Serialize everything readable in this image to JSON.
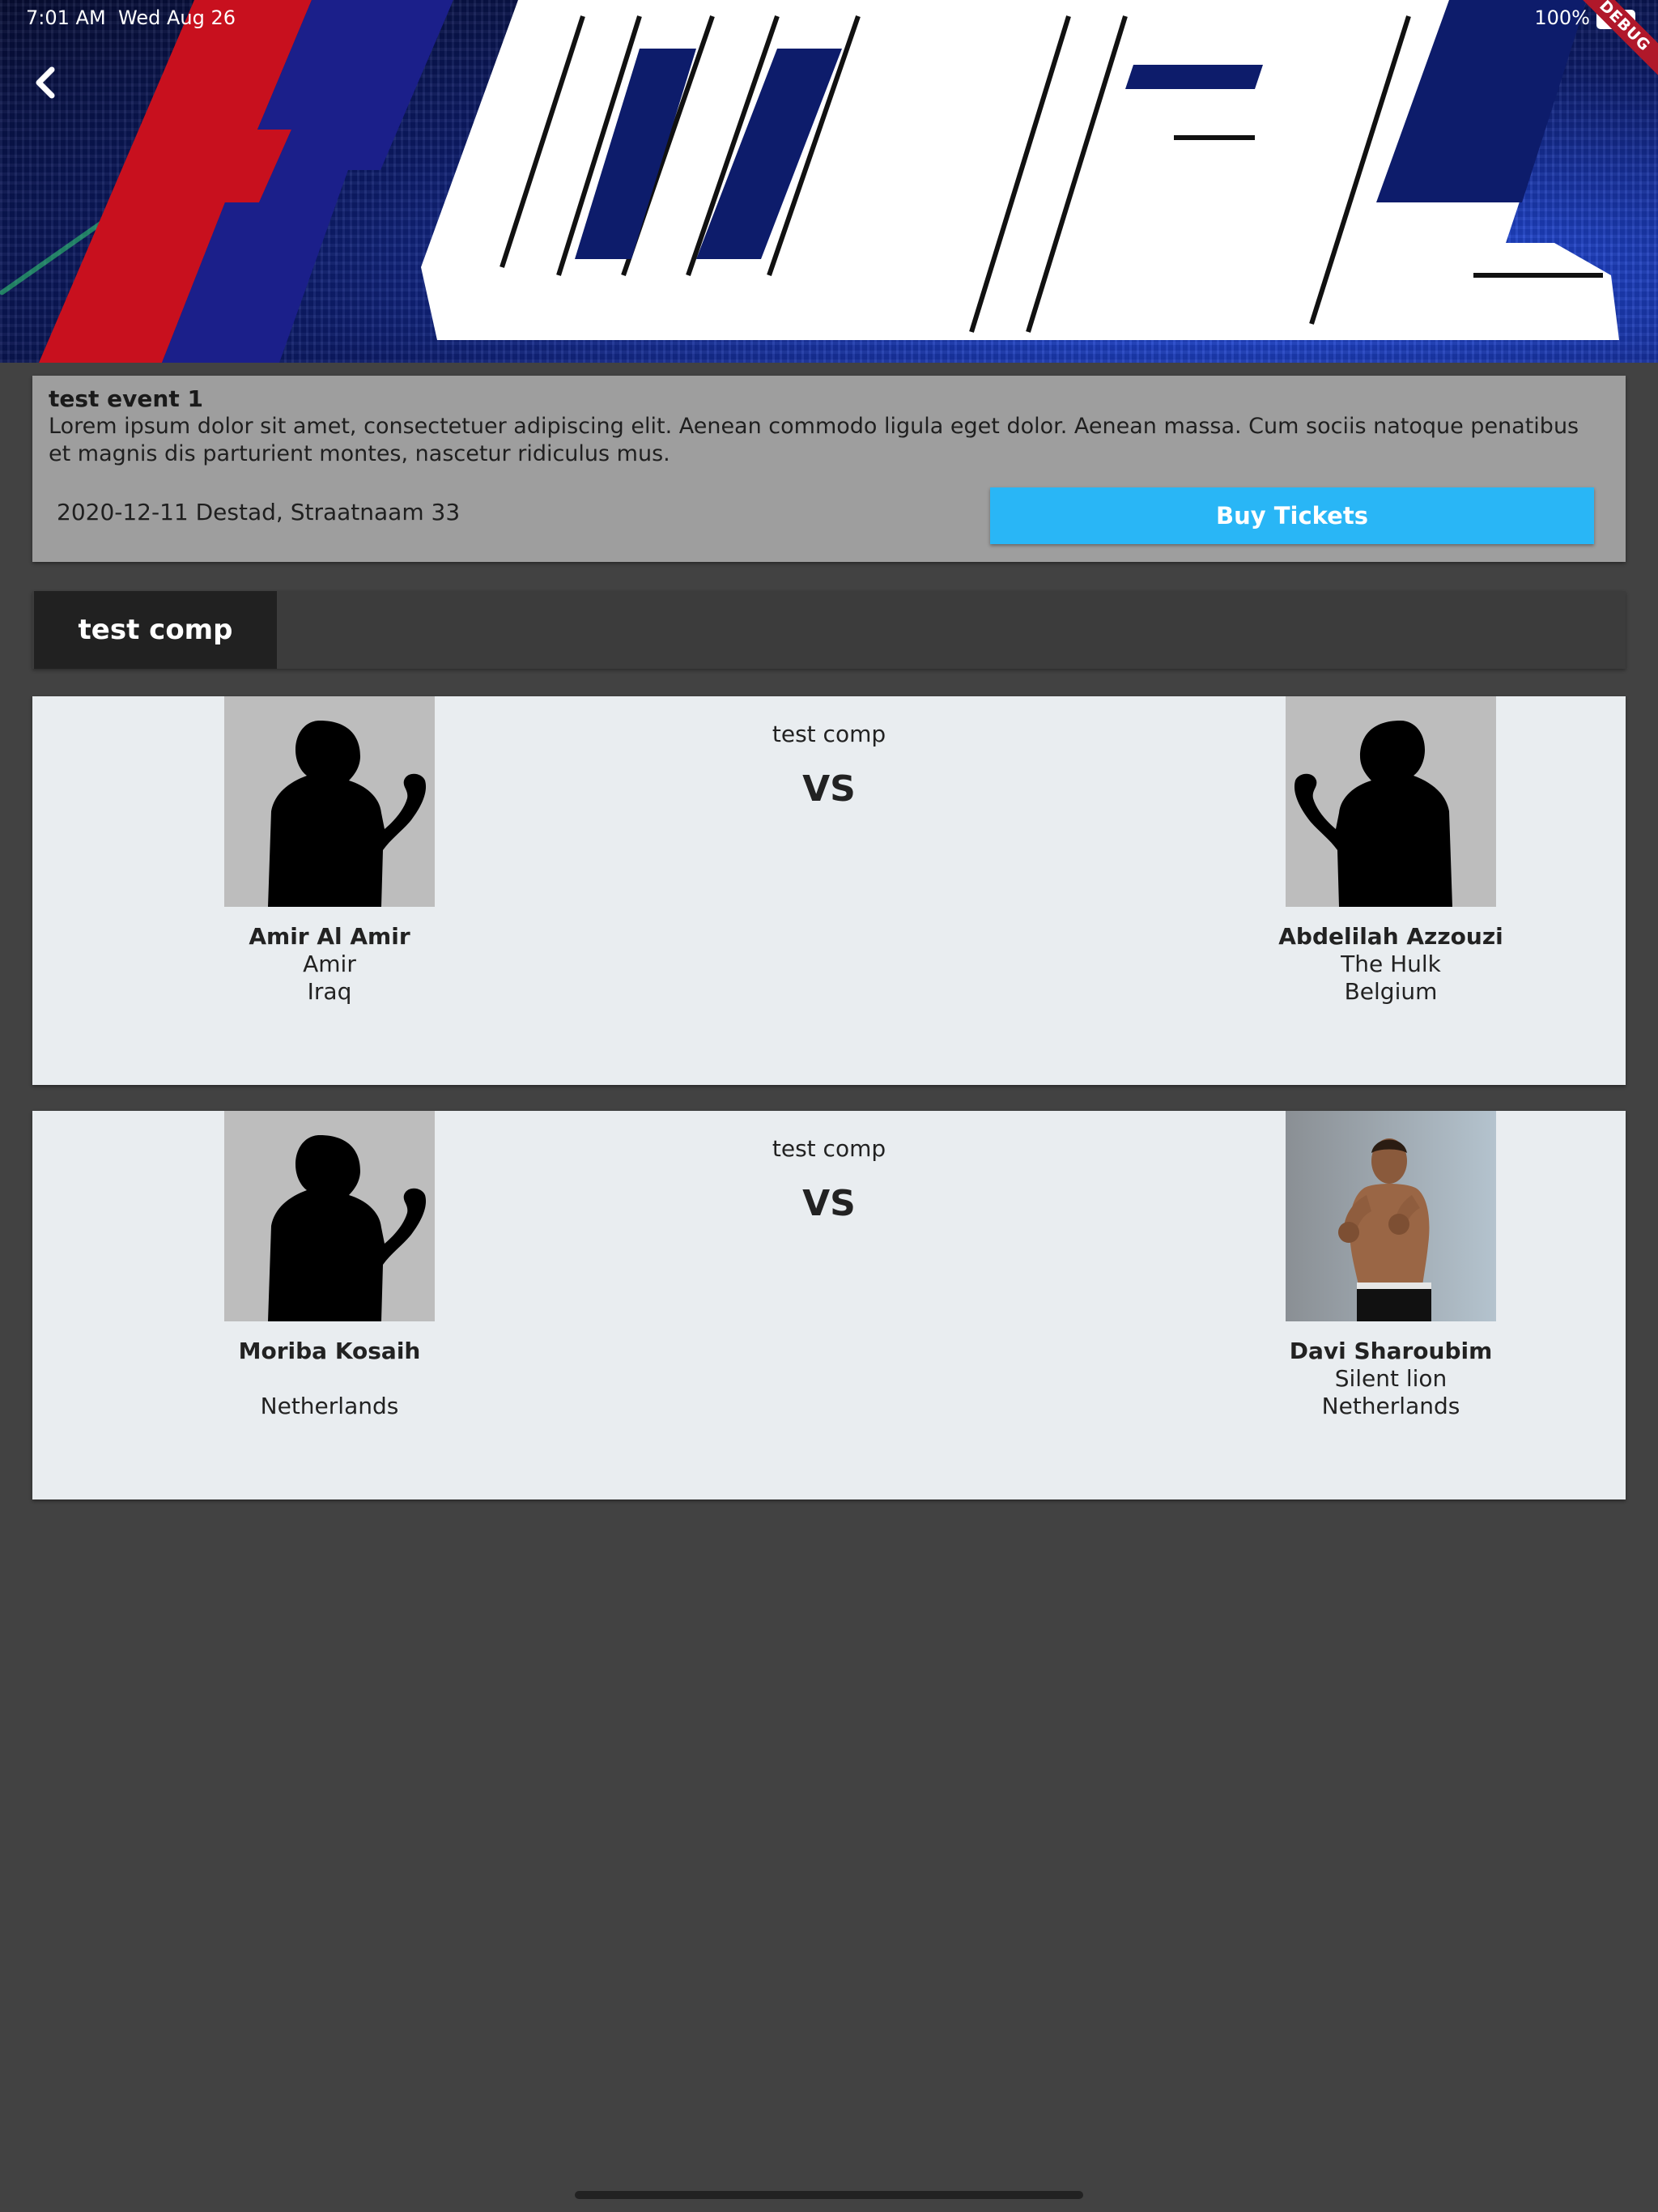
{
  "status_bar": {
    "time": "7:01 AM",
    "date": "Wed Aug 26",
    "battery": "100%",
    "debug_label": "DEBUG"
  },
  "hero": {
    "logo_text": "FWFL",
    "back_icon": "chevron-left-icon"
  },
  "event": {
    "title": "test event 1",
    "description": "Lorem ipsum dolor sit amet, consectetuer adipiscing elit. Aenean commodo ligula eget dolor. Aenean massa. Cum sociis natoque penatibus et magnis dis parturient montes, nascetur ridiculus mus.",
    "date_location": "2020-12-11 Destad, Straatnaam 33",
    "buy_label": "Buy Tickets",
    "buy_color": "#29b6f6"
  },
  "tabs": [
    {
      "label": "test comp",
      "active": true
    }
  ],
  "fights": [
    {
      "competition": "test comp",
      "vs_label": "VS",
      "left": {
        "name": "Amir Al Amir",
        "nickname": "Amir",
        "country": "Iraq",
        "photo": "silhouette"
      },
      "right": {
        "name": "Abdelilah Azzouzi",
        "nickname": "The Hulk",
        "country": "Belgium",
        "photo": "silhouette"
      }
    },
    {
      "competition": "test comp",
      "vs_label": "VS",
      "left": {
        "name": "Moriba Kosaih",
        "nickname": "",
        "country": "Netherlands",
        "photo": "silhouette"
      },
      "right": {
        "name": "Davi Sharoubim",
        "nickname": "Silent lion",
        "country": "Netherlands",
        "photo": "photo"
      }
    }
  ]
}
